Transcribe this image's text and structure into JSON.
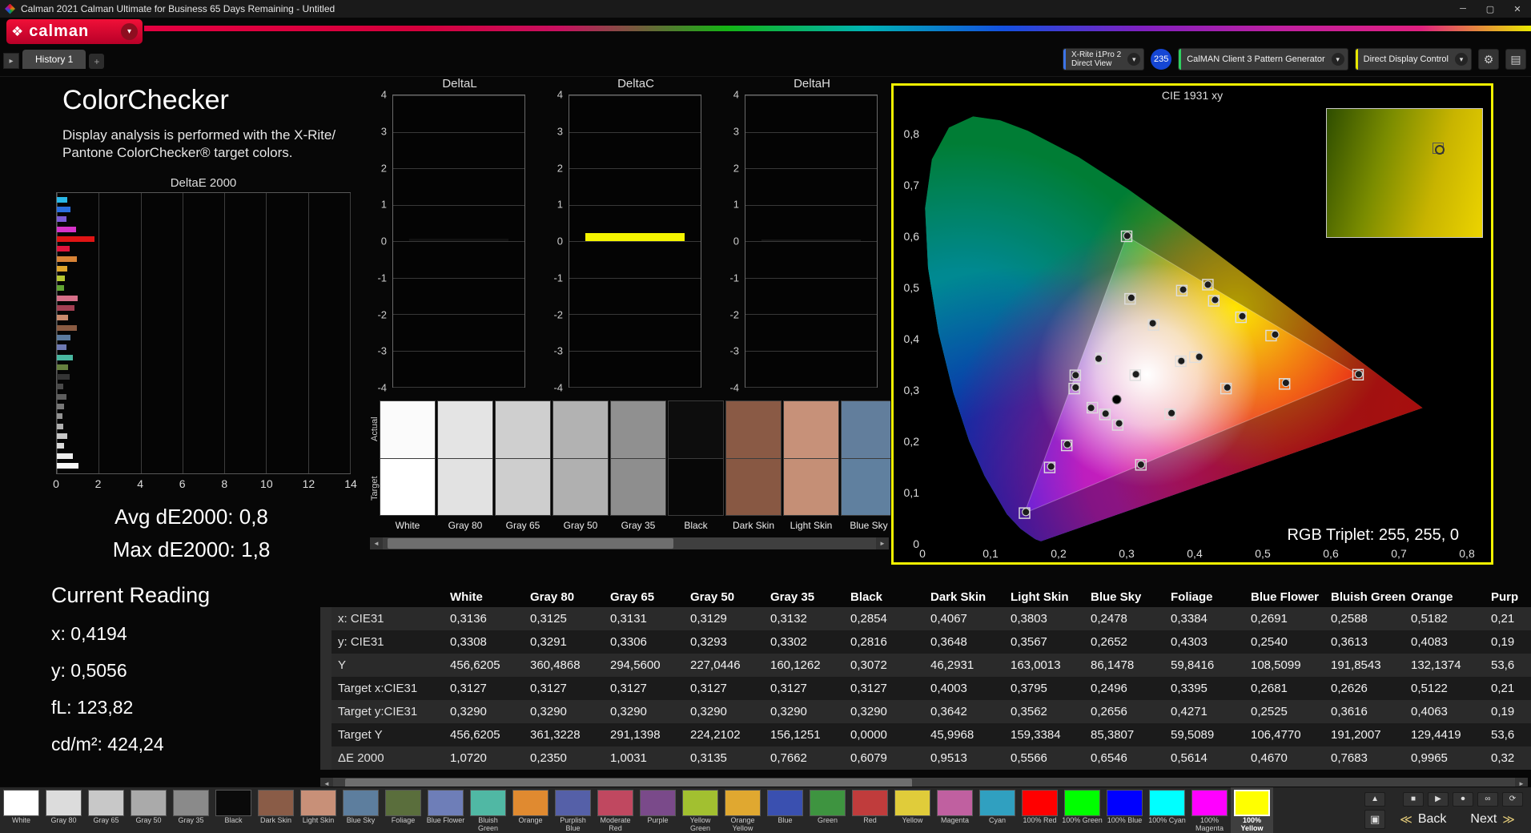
{
  "window": {
    "title": "Calman 2021 Calman Ultimate for Business 65 Days Remaining  - Untitled"
  },
  "icons": {
    "chevron_down": "▾",
    "gear": "⚙",
    "layout": "▤",
    "minimize": "─",
    "maximize": "▢",
    "close": "✕",
    "tab_nav": "▸",
    "left": "◄",
    "right": "►",
    "up": "▲",
    "stop": "■",
    "play": "▶",
    "record": "⏺",
    "link": "∞",
    "refresh": "⟳",
    "window_btn": "▣",
    "back_chevrons": "≪",
    "next_chevrons": "≫",
    "logo_mark": "❖"
  },
  "header": {
    "logo_text": "calman",
    "meter_line1": "X-Rite i1Pro 2",
    "meter_line2": "Direct View",
    "meter_accent": "#3c74e8",
    "badge": "235",
    "badge_color": "#1546d4",
    "source_label": "CalMAN Client 3 Pattern Generator",
    "source_accent": "#2ed060",
    "display_label": "Direct Display Control",
    "display_accent": "#e8e800"
  },
  "tabs": {
    "history": "History 1",
    "add": "+"
  },
  "left_panel": {
    "title": "ColorChecker",
    "description_line1": "Display analysis is performed with the X-Rite/",
    "description_line2": "Pantone ColorChecker® target colors.",
    "bar_chart": {
      "title": "DeltaE 2000",
      "x_ticks": [
        "0",
        "2",
        "4",
        "6",
        "8",
        "10",
        "12",
        "14"
      ],
      "x_max": 14,
      "bars": [
        {
          "c": "#29b8e8",
          "v": 0.5
        },
        {
          "c": "#2a6fe0",
          "v": 0.65
        },
        {
          "c": "#7a5bd6",
          "v": 0.45
        },
        {
          "c": "#d633c8",
          "v": 0.9
        },
        {
          "c": "#e01414",
          "v": 1.8
        },
        {
          "c": "#e0143c",
          "v": 0.6
        },
        {
          "c": "#d98436",
          "v": 0.95
        },
        {
          "c": "#dfa52b",
          "v": 0.5
        },
        {
          "c": "#b6c832",
          "v": 0.4
        },
        {
          "c": "#61a433",
          "v": 0.35
        },
        {
          "c": "#d66f88",
          "v": 1.0
        },
        {
          "c": "#a23f52",
          "v": 0.85
        },
        {
          "c": "#c98a6c",
          "v": 0.55
        },
        {
          "c": "#8a5b42",
          "v": 0.95
        },
        {
          "c": "#5a7a9e",
          "v": 0.65
        },
        {
          "c": "#6d79b2",
          "v": 0.45
        },
        {
          "c": "#49b7a0",
          "v": 0.75
        },
        {
          "c": "#66813f",
          "v": 0.55
        },
        {
          "c": "#343434",
          "v": 0.6
        },
        {
          "c": "#4a4a4a",
          "v": 0.3
        },
        {
          "c": "#5e5e5e",
          "v": 0.45
        },
        {
          "c": "#787878",
          "v": 0.35
        },
        {
          "c": "#949494",
          "v": 0.25
        },
        {
          "c": "#b0b0b0",
          "v": 0.3
        },
        {
          "c": "#c8c8c8",
          "v": 0.5
        },
        {
          "c": "#dcdcdc",
          "v": 0.35
        },
        {
          "c": "#ededed",
          "v": 0.75
        },
        {
          "c": "#f8f8f8",
          "v": 1.05
        }
      ]
    },
    "avg_label": "Avg dE2000: 0,8",
    "max_label": "Max dE2000: 1,8",
    "current_reading": {
      "title": "Current Reading",
      "x": "x: 0,4194",
      "y": "y: 0,5056",
      "fl": "fL: 123,82",
      "cdm2": "cd/m²: 424,24"
    }
  },
  "delta_y_ticks": [
    "4",
    "3",
    "2",
    "1",
    "0",
    "-1",
    "-2",
    "-3",
    "-4"
  ],
  "delta_charts": [
    {
      "title": "DeltaL",
      "value": 0.06,
      "color": "#101010"
    },
    {
      "title": "DeltaC",
      "value": 0.22,
      "color": "#f5f500"
    },
    {
      "title": "DeltaH",
      "value": 0.05,
      "color": "#161616"
    }
  ],
  "swatch_strip": {
    "row_labels": [
      "Actual",
      "Target"
    ],
    "swatches": [
      {
        "label": "White",
        "actual": "#fbfbfb",
        "target": "#ffffff"
      },
      {
        "label": "Gray 80",
        "actual": "#e4e4e4",
        "target": "#e2e2e2"
      },
      {
        "label": "Gray 65",
        "actual": "#cfcfcf",
        "target": "#cecece"
      },
      {
        "label": "Gray 50",
        "actual": "#b2b2b2",
        "target": "#b0b0b0"
      },
      {
        "label": "Gray 35",
        "actual": "#909090",
        "target": "#8e8e8e"
      },
      {
        "label": "Black",
        "actual": "#0d0d0d",
        "target": "#070707"
      },
      {
        "label": "Dark Skin",
        "actual": "#8a5a45",
        "target": "#885843"
      },
      {
        "label": "Light Skin",
        "actual": "#c79179",
        "target": "#c58f76"
      },
      {
        "label": "Blue Sky",
        "actual": "#627e9c",
        "target": "#60809f"
      }
    ]
  },
  "cie_chart": {
    "title": "CIE 1931 xy",
    "x_ticks": [
      "0",
      "0,1",
      "0,2",
      "0,3",
      "0,4",
      "0,5",
      "0,6",
      "0,7",
      "0,8"
    ],
    "y_ticks": [
      "0,8",
      "0,7",
      "0,6",
      "0,5",
      "0,4",
      "0,3",
      "0,2",
      "0,1",
      "0"
    ],
    "rgb_triplet": "RGB Triplet: 255, 255, 0",
    "gamut_triangle": [
      [
        0.64,
        0.33
      ],
      [
        0.3,
        0.6
      ],
      [
        0.15,
        0.06
      ]
    ],
    "targets": [
      [
        0.3127,
        0.329
      ],
      [
        0.4003,
        0.3642
      ],
      [
        0.3795,
        0.3562
      ],
      [
        0.2496,
        0.2656
      ],
      [
        0.3395,
        0.4271
      ],
      [
        0.2681,
        0.2525
      ],
      [
        0.2626,
        0.3616
      ],
      [
        0.5122,
        0.4063
      ],
      [
        0.212,
        0.192
      ],
      [
        0.446,
        0.303
      ],
      [
        0.287,
        0.232
      ],
      [
        0.381,
        0.494
      ],
      [
        0.468,
        0.442
      ],
      [
        0.187,
        0.149
      ],
      [
        0.305,
        0.478
      ],
      [
        0.532,
        0.312
      ],
      [
        0.428,
        0.474
      ],
      [
        0.364,
        0.253
      ],
      [
        0.223,
        0.303
      ],
      [
        0.64,
        0.33
      ],
      [
        0.3,
        0.6
      ],
      [
        0.15,
        0.06
      ],
      [
        0.2246,
        0.3287
      ],
      [
        0.3209,
        0.1542
      ],
      [
        0.4193,
        0.5056
      ]
    ],
    "measurements": [
      [
        0.3136,
        0.3308
      ],
      [
        0.4067,
        0.3648
      ],
      [
        0.3803,
        0.3567
      ],
      [
        0.2478,
        0.2652
      ],
      [
        0.3384,
        0.4303
      ],
      [
        0.2691,
        0.254
      ],
      [
        0.2588,
        0.3613
      ],
      [
        0.5182,
        0.4083
      ],
      [
        0.213,
        0.194
      ],
      [
        0.448,
        0.305
      ],
      [
        0.289,
        0.235
      ],
      [
        0.383,
        0.496
      ],
      [
        0.47,
        0.444
      ],
      [
        0.189,
        0.151
      ],
      [
        0.307,
        0.48
      ],
      [
        0.534,
        0.314
      ],
      [
        0.43,
        0.476
      ],
      [
        0.366,
        0.255
      ],
      [
        0.225,
        0.305
      ],
      [
        0.641,
        0.331
      ],
      [
        0.301,
        0.601
      ],
      [
        0.152,
        0.062
      ],
      [
        0.225,
        0.329
      ],
      [
        0.321,
        0.1545
      ],
      [
        0.4194,
        0.5056
      ]
    ],
    "black_point": [
      0.2854,
      0.2816
    ]
  },
  "table": {
    "columns": [
      "White",
      "Gray 80",
      "Gray 65",
      "Gray 50",
      "Gray 35",
      "Black",
      "Dark Skin",
      "Light Skin",
      "Blue Sky",
      "Foliage",
      "Blue Flower",
      "Bluish Green",
      "Orange",
      "Purp"
    ],
    "rows": [
      {
        "label": "x: CIE31",
        "values": [
          "0,3136",
          "0,3125",
          "0,3131",
          "0,3129",
          "0,3132",
          "0,2854",
          "0,4067",
          "0,3803",
          "0,2478",
          "0,3384",
          "0,2691",
          "0,2588",
          "0,5182",
          "0,21"
        ]
      },
      {
        "label": "y: CIE31",
        "values": [
          "0,3308",
          "0,3291",
          "0,3306",
          "0,3293",
          "0,3302",
          "0,2816",
          "0,3648",
          "0,3567",
          "0,2652",
          "0,4303",
          "0,2540",
          "0,3613",
          "0,4083",
          "0,19"
        ]
      },
      {
        "label": "Y",
        "values": [
          "456,6205",
          "360,4868",
          "294,5600",
          "227,0446",
          "160,1262",
          "0,3072",
          "46,2931",
          "163,0013",
          "86,1478",
          "59,8416",
          "108,5099",
          "191,8543",
          "132,1374",
          "53,6"
        ]
      },
      {
        "label": "Target x:CIE31",
        "values": [
          "0,3127",
          "0,3127",
          "0,3127",
          "0,3127",
          "0,3127",
          "0,3127",
          "0,4003",
          "0,3795",
          "0,2496",
          "0,3395",
          "0,2681",
          "0,2626",
          "0,5122",
          "0,21"
        ]
      },
      {
        "label": "Target y:CIE31",
        "values": [
          "0,3290",
          "0,3290",
          "0,3290",
          "0,3290",
          "0,3290",
          "0,3290",
          "0,3642",
          "0,3562",
          "0,2656",
          "0,4271",
          "0,2525",
          "0,3616",
          "0,4063",
          "0,19"
        ]
      },
      {
        "label": "Target Y",
        "values": [
          "456,6205",
          "361,3228",
          "291,1398",
          "224,2102",
          "156,1251",
          "0,0000",
          "45,9968",
          "159,3384",
          "85,3807",
          "59,5089",
          "106,4770",
          "191,2007",
          "129,4419",
          "53,6"
        ]
      },
      {
        "label": "ΔE 2000",
        "values": [
          "1,0720",
          "0,2350",
          "1,0031",
          "0,3135",
          "0,7662",
          "0,6079",
          "0,9513",
          "0,5566",
          "0,6546",
          "0,5614",
          "0,4670",
          "0,7683",
          "0,9965",
          "0,32"
        ]
      }
    ]
  },
  "toolbar": {
    "back_label": "Back",
    "next_label": "Next",
    "swatches": [
      {
        "label": "White",
        "color": "#ffffff"
      },
      {
        "label": "Gray 80",
        "color": "#dcdcdc"
      },
      {
        "label": "Gray 65",
        "color": "#c8c8c8"
      },
      {
        "label": "Gray 50",
        "color": "#aaaaaa"
      },
      {
        "label": "Gray 35",
        "color": "#8a8a8a"
      },
      {
        "label": "Black",
        "color": "#0a0a0a"
      },
      {
        "label": "Dark Skin",
        "color": "#8a5c47"
      },
      {
        "label": "Light Skin",
        "color": "#c89078"
      },
      {
        "label": "Blue Sky",
        "color": "#5d7e9e"
      },
      {
        "label": "Foliage",
        "color": "#5a6e3c"
      },
      {
        "label": "Blue Flower",
        "color": "#6e7eb8"
      },
      {
        "label": "Bluish Green",
        "color": "#50b8a4"
      },
      {
        "label": "Orange",
        "color": "#e08a30"
      },
      {
        "label": "Purplish Blue",
        "color": "#5560a8"
      },
      {
        "label": "Moderate Red",
        "color": "#c04860"
      },
      {
        "label": "Purple",
        "color": "#7a4a8a"
      },
      {
        "label": "Yellow Green",
        "color": "#a2c030"
      },
      {
        "label": "Orange Yellow",
        "color": "#e0a830"
      },
      {
        "label": "Blue",
        "color": "#3a50b0"
      },
      {
        "label": "Green",
        "color": "#3e9440"
      },
      {
        "label": "Red",
        "color": "#c03c3c"
      },
      {
        "label": "Yellow",
        "color": "#e0cc3a"
      },
      {
        "label": "Magenta",
        "color": "#c060a0"
      },
      {
        "label": "Cyan",
        "color": "#30a0c0"
      },
      {
        "label": "100% Red",
        "color": "#ff0000"
      },
      {
        "label": "100% Green",
        "color": "#00ff00"
      },
      {
        "label": "100% Blue",
        "color": "#0000ff"
      },
      {
        "label": "100% Cyan",
        "color": "#00ffff"
      },
      {
        "label": "100% Magenta",
        "color": "#ff00ff"
      },
      {
        "label": "100% Yellow",
        "color": "#ffff00",
        "selected": true
      }
    ]
  }
}
